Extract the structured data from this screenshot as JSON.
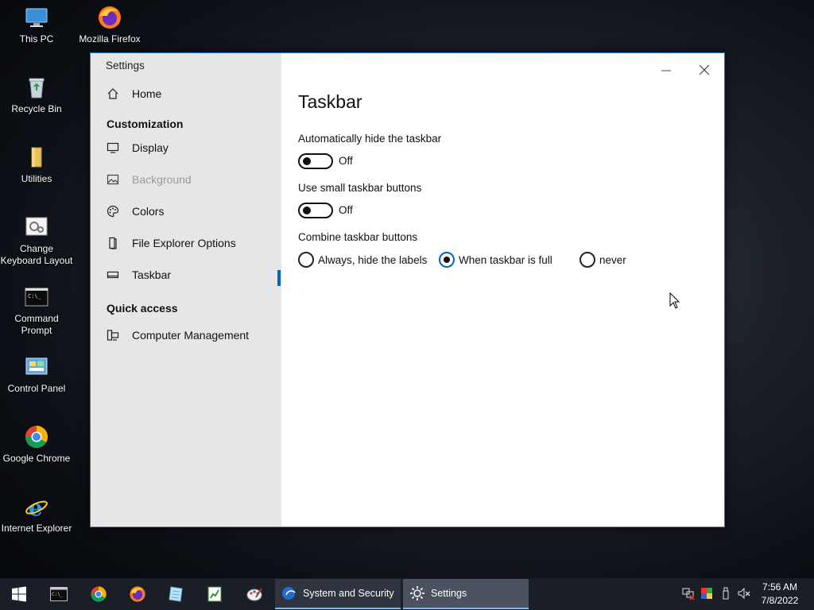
{
  "desktop": {
    "icons": [
      {
        "label": "This PC",
        "icon": "this-pc-icon"
      },
      {
        "label": "Mozilla Firefox",
        "icon": "firefox-icon"
      },
      {
        "label": "Recycle Bin",
        "icon": "recycle-bin-icon"
      },
      {
        "label": "Utilities",
        "icon": "folder-icon"
      },
      {
        "label": "Change Keyboard Layout",
        "icon": "keyboard-settings-icon"
      },
      {
        "label": "Command Prompt",
        "icon": "command-prompt-icon"
      },
      {
        "label": "Control Panel",
        "icon": "control-panel-icon"
      },
      {
        "label": "Google Chrome",
        "icon": "chrome-icon"
      },
      {
        "label": "Internet Explorer",
        "icon": "internet-explorer-icon"
      }
    ]
  },
  "window": {
    "title": "Settings",
    "sidebar": {
      "home": "Home",
      "section_customization": "Customization",
      "items": [
        {
          "label": "Display",
          "icon": "monitor-icon",
          "disabled": false
        },
        {
          "label": "Background",
          "icon": "picture-icon",
          "disabled": true
        },
        {
          "label": "Colors",
          "icon": "palette-icon",
          "disabled": false
        },
        {
          "label": "File Explorer Options",
          "icon": "file-explorer-icon",
          "disabled": false
        },
        {
          "label": "Taskbar",
          "icon": "taskbar-icon",
          "disabled": false,
          "selected": true
        }
      ],
      "section_quick_access": "Quick access",
      "quick_access_items": [
        {
          "label": "Computer Management",
          "icon": "computer-management-icon"
        }
      ]
    },
    "content": {
      "title": "Taskbar",
      "auto_hide": {
        "label": "Automatically hide the taskbar",
        "state": "Off"
      },
      "small_buttons": {
        "label": "Use small taskbar buttons",
        "state": "Off"
      },
      "combine": {
        "label": "Combine taskbar buttons",
        "options": [
          {
            "label": "Always, hide the labels",
            "checked": false
          },
          {
            "label": "When taskbar is full",
            "checked": true
          },
          {
            "label": "never",
            "checked": false
          }
        ]
      }
    }
  },
  "taskbar": {
    "pinned": [
      "start-icon",
      "command-prompt-icon",
      "chrome-icon",
      "firefox-icon",
      "notepad-icon",
      "spreadsheet-icon",
      "paint-icon"
    ],
    "windows": [
      {
        "label": "System and Security",
        "icon": "system-security-icon"
      },
      {
        "label": "Settings",
        "icon": "gear-icon",
        "active": true
      }
    ],
    "tray": [
      "network-icon",
      "color-icon",
      "usb-icon",
      "volume-muted-icon"
    ],
    "clock": {
      "time": "7:56 AM",
      "date": "7/8/2022"
    }
  },
  "colors": {
    "accent": "#0067c0",
    "sidebar_bg": "#e6e6e6",
    "taskbar_bg": "#1a1f27",
    "taskbar_active": "#4a5260"
  }
}
